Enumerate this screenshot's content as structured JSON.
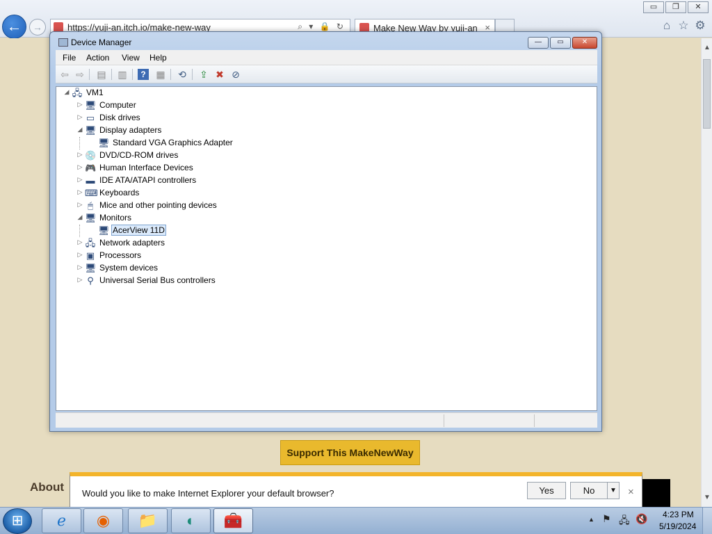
{
  "browser": {
    "address_url": "https://yuji-an.itch.io/make-new-way",
    "tab_title": "Make New Way by yuji-an",
    "tab_close_glyph": "×",
    "back_glyph": "←",
    "forward_glyph": "→",
    "address_icons": "⌕ ▾ 🔒 ↻",
    "window_buttons": {
      "minimize": "▭",
      "maximize": "❐",
      "close": "✕"
    },
    "tool_icons": {
      "home": "⌂",
      "favorites": "☆",
      "settings": "⚙"
    }
  },
  "webpage": {
    "support_button": "Support This MakeNewWay",
    "about_heading": "About",
    "scroll_up": "▲",
    "scroll_down": "▼"
  },
  "device_manager": {
    "title": "Device Manager",
    "window_buttons": {
      "minimize": "—",
      "maximize": "▭",
      "close": "✕"
    },
    "menu": [
      "File",
      "Action",
      "View",
      "Help"
    ],
    "toolbar_icons": {
      "back": "⇦",
      "forward": "⇨",
      "properties_pane": "▤",
      "show_hidden": "▥",
      "help": "?",
      "action_pane": "▦",
      "scan": "⟲",
      "update_driver": "⇪",
      "uninstall": "✖",
      "disable": "⊘"
    },
    "tree": {
      "root": {
        "label": "VM1",
        "toggle": "◢",
        "icon": "🖧"
      },
      "categories": [
        {
          "label": "Computer",
          "toggle": "▷",
          "icon": "🖥",
          "children": []
        },
        {
          "label": "Disk drives",
          "toggle": "▷",
          "icon": "▭",
          "children": []
        },
        {
          "label": "Display adapters",
          "toggle": "◢",
          "icon": "🖥",
          "children": [
            {
              "label": "Standard VGA Graphics Adapter",
              "icon": "🖥",
              "selected": false
            }
          ]
        },
        {
          "label": "DVD/CD-ROM drives",
          "toggle": "▷",
          "icon": "💿",
          "children": []
        },
        {
          "label": "Human Interface Devices",
          "toggle": "▷",
          "icon": "🎮",
          "children": []
        },
        {
          "label": "IDE ATA/ATAPI controllers",
          "toggle": "▷",
          "icon": "▬",
          "children": []
        },
        {
          "label": "Keyboards",
          "toggle": "▷",
          "icon": "⌨",
          "children": []
        },
        {
          "label": "Mice and other pointing devices",
          "toggle": "▷",
          "icon": "🖱",
          "children": []
        },
        {
          "label": "Monitors",
          "toggle": "◢",
          "icon": "🖥",
          "children": [
            {
              "label": "AcerView 11D",
              "icon": "🖥",
              "selected": true
            }
          ]
        },
        {
          "label": "Network adapters",
          "toggle": "▷",
          "icon": "🖧",
          "children": []
        },
        {
          "label": "Processors",
          "toggle": "▷",
          "icon": "▣",
          "children": []
        },
        {
          "label": "System devices",
          "toggle": "▷",
          "icon": "🖥",
          "children": []
        },
        {
          "label": "Universal Serial Bus controllers",
          "toggle": "▷",
          "icon": "⚲",
          "children": []
        }
      ]
    }
  },
  "notification": {
    "message": "Would you like to make Internet Explorer your default browser?",
    "yes_label": "Yes",
    "no_label": "No",
    "dropdown_glyph": "▼",
    "close_glyph": "×"
  },
  "taskbar": {
    "start_glyph": "⊞",
    "apps": [
      {
        "name": "internet-explorer",
        "glyph": "ℯ",
        "color": "#1e74c9"
      },
      {
        "name": "firefox",
        "glyph": "◉",
        "color": "#e66000"
      },
      {
        "name": "file-explorer",
        "glyph": "📁",
        "color": "#d9a72b"
      },
      {
        "name": "app-teal",
        "glyph": "◐",
        "color": "#1d8c7a"
      },
      {
        "name": "toolbox",
        "glyph": "🧰",
        "color": "#c0392b"
      }
    ],
    "tray": {
      "show_hidden": "▲",
      "flag": "⚑",
      "network": "🖧",
      "volume": "🔇"
    },
    "time": "4:23 PM",
    "date": "5/19/2024"
  }
}
